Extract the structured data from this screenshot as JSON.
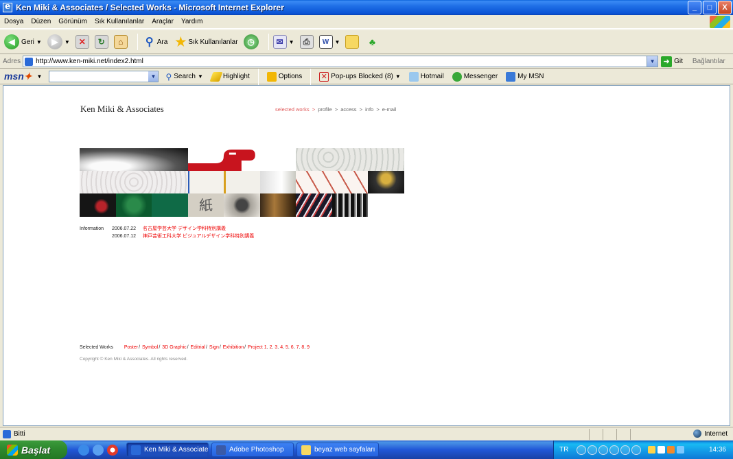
{
  "window": {
    "title": "Ken Miki & Associates / Selected Works - Microsoft Internet Explorer",
    "minimize_label": "_",
    "maximize_label": "□",
    "close_label": "X"
  },
  "menu": {
    "items": [
      {
        "label": "Dosya"
      },
      {
        "label": "Düzen"
      },
      {
        "label": "Görünüm"
      },
      {
        "label": "Sık Kullanılanlar"
      },
      {
        "label": "Araçlar"
      },
      {
        "label": "Yardım"
      }
    ]
  },
  "toolbar": {
    "back_label": "Geri",
    "search_label": "Ara",
    "favorites_label": "Sık Kullanılanlar"
  },
  "address": {
    "label": "Adres",
    "url": "http://www.ken-miki.net/index2.html",
    "go_label": "Git",
    "links_label": "Bağlantılar"
  },
  "msn": {
    "search_label": "Search",
    "highlight_label": "Highlight",
    "options_label": "Options",
    "popups_label": "Pop-ups Blocked (8)",
    "hotmail_label": "Hotmail",
    "messenger_label": "Messenger",
    "mymsn_label": "My MSN"
  },
  "page": {
    "brand": "Ken Miki & Associates",
    "nav": {
      "selected_works": "selected works",
      "profile": "profile",
      "access": "access",
      "info": "info",
      "email": "e-mail",
      "arrow": ">"
    },
    "information": {
      "label": "Information",
      "items": [
        {
          "date": "2006.07.22",
          "text": "名古屋学芸大学 デザイン学科特別講義"
        },
        {
          "date": "2006.07.12",
          "text": "神戸芸術工科大学 ビジュアルデザイン学科特別講義"
        }
      ]
    },
    "works": {
      "label": "Selected Works",
      "categories": [
        "Poster",
        "Symbol",
        "3D Graphic",
        "Editrial",
        "Sign",
        "Exhibition"
      ],
      "project_label": "Project",
      "project_pages": [
        "1",
        "2",
        "3",
        "4",
        "5",
        "6",
        "7",
        "8",
        "9"
      ]
    },
    "copyright": "Copyright © Ken Miki & Associates. All rights reserved."
  },
  "status": {
    "text": "Bitti",
    "zone": "Internet"
  },
  "taskbar": {
    "start_label": "Başlat",
    "tasks": [
      {
        "label": "Ken Miki & Associates..."
      },
      {
        "label": "Adobe Photoshop"
      },
      {
        "label": "beyaz web sayfaları"
      }
    ],
    "lang": "TR",
    "clock": "14:36"
  }
}
